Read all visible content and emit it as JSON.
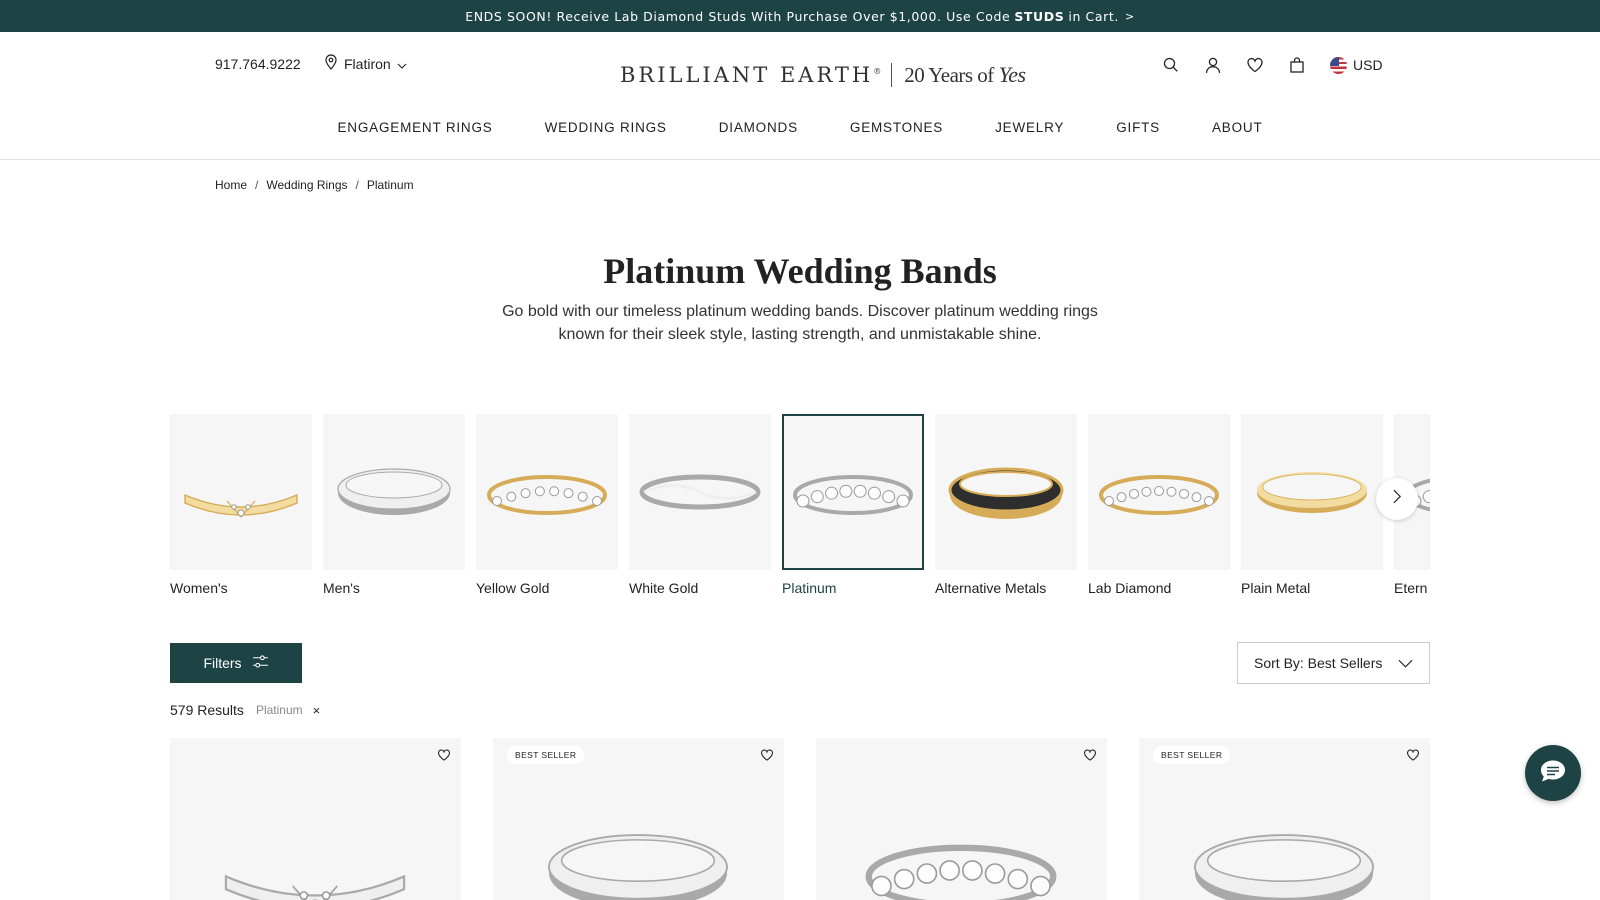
{
  "promo": {
    "text_before": "ENDS SOON! Receive Lab Diamond Studs With Purchase Over $1,000. Use Code",
    "code": "STUDS",
    "text_after": "in Cart.",
    "arrow": ">"
  },
  "header": {
    "phone": "917.764.9222",
    "store": "Flatiron",
    "logo_main": "BRILLIANT EARTH",
    "logo_mark": "®",
    "logo_tag_prefix": "20 Years of",
    "logo_tag_script": "Yes",
    "currency": "USD"
  },
  "nav": [
    "ENGAGEMENT RINGS",
    "WEDDING RINGS",
    "DIAMONDS",
    "GEMSTONES",
    "JEWELRY",
    "GIFTS",
    "ABOUT"
  ],
  "breadcrumb": [
    "Home",
    "Wedding Rings",
    "Platinum"
  ],
  "page": {
    "title": "Platinum Wedding Bands",
    "description": "Go bold with our timeless platinum wedding bands. Discover platinum wedding rings known for their sleek style, lasting strength, and unmistakable shine."
  },
  "categories": [
    {
      "label": "Women's",
      "metal": "gold",
      "style": "curved"
    },
    {
      "label": "Men's",
      "metal": "silver",
      "style": "plain-wide"
    },
    {
      "label": "Yellow Gold",
      "metal": "gold",
      "style": "stones"
    },
    {
      "label": "White Gold",
      "metal": "silver",
      "style": "twist"
    },
    {
      "label": "Platinum",
      "metal": "silver",
      "style": "eternity",
      "active": true
    },
    {
      "label": "Alternative Metals",
      "metal": "black-gold",
      "style": "inlay"
    },
    {
      "label": "Lab Diamond",
      "metal": "gold",
      "style": "cluster"
    },
    {
      "label": "Plain Metal",
      "metal": "gold",
      "style": "plain"
    },
    {
      "label": "Etern",
      "metal": "silver",
      "style": "eternity"
    }
  ],
  "toolbar": {
    "filters_label": "Filters",
    "sort_label": "Sort By: Best Sellers"
  },
  "results": {
    "count_label": "579 Results",
    "active_filter": "Platinum",
    "clear_symbol": "×"
  },
  "products": [
    {
      "badge": "",
      "style": "curved"
    },
    {
      "badge": "BEST SELLER",
      "style": "plain-wide"
    },
    {
      "badge": "",
      "style": "eternity"
    },
    {
      "badge": "BEST SELLER",
      "style": "brushed"
    }
  ],
  "colors": {
    "brand": "#1e4344",
    "gold": "#e3c27a",
    "silver": "#cfcfcf"
  },
  "icons": [
    "location-pin-icon",
    "chevron-down-icon",
    "search-icon",
    "account-icon",
    "heart-icon",
    "bag-icon",
    "us-flag-icon",
    "chevron-right-icon",
    "filter-sliders-icon",
    "chat-icon"
  ]
}
